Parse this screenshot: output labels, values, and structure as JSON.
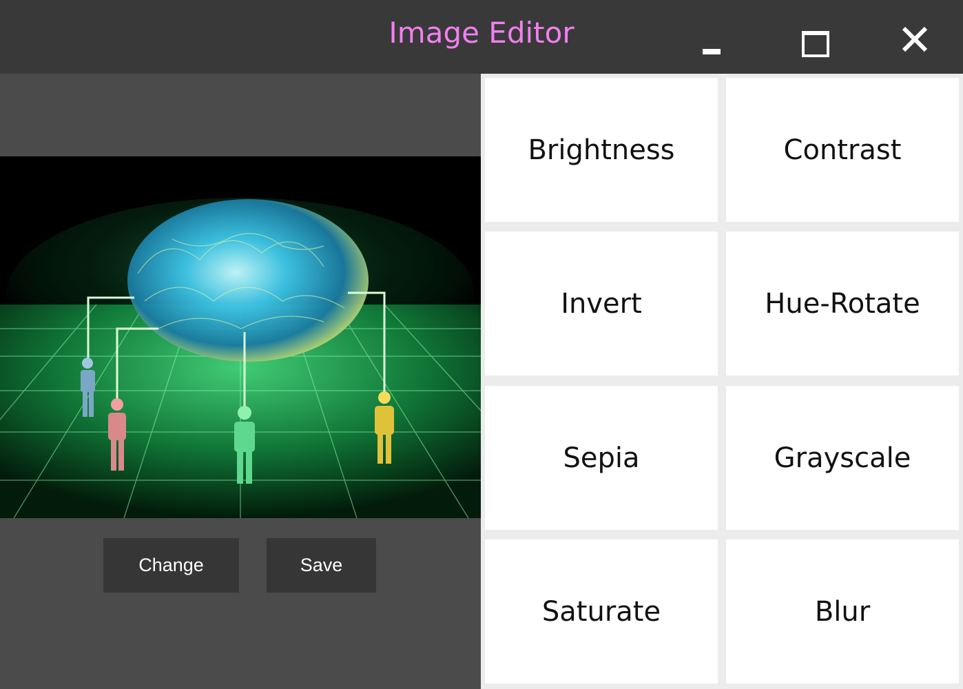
{
  "window": {
    "title": "Image Editor",
    "title_color": "#f080f0",
    "controls": [
      "minimize-icon",
      "maximize-icon",
      "close-icon"
    ]
  },
  "image": {
    "description_icon": "brain-network-image"
  },
  "actions": {
    "change_label": "Change",
    "save_label": "Save"
  },
  "filters": [
    {
      "label": "Brightness"
    },
    {
      "label": "Contrast"
    },
    {
      "label": "Invert"
    },
    {
      "label": "Hue-Rotate"
    },
    {
      "label": "Sepia"
    },
    {
      "label": "Grayscale"
    },
    {
      "label": "Saturate"
    },
    {
      "label": "Blur"
    }
  ],
  "colors": {
    "titlebar": "#393939",
    "pane": "#4b4b4b",
    "button": "#363636",
    "grid_bg": "#ececec"
  }
}
